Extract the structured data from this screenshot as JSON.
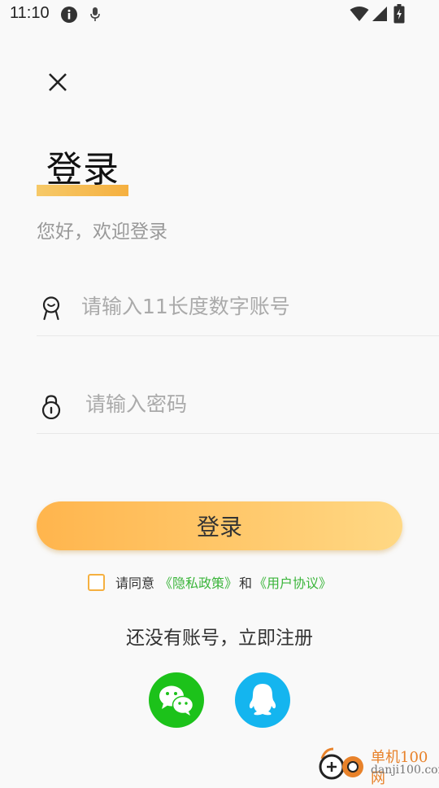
{
  "status_bar": {
    "time": "11:10",
    "icons": [
      "info-icon",
      "mic-icon",
      "wifi-icon",
      "signal-icon",
      "battery-icon"
    ]
  },
  "header": {
    "close_icon": "close-icon",
    "title": "登录",
    "subtitle": "您好，欢迎登录"
  },
  "form": {
    "account": {
      "placeholder": "请输入11长度数字账号",
      "value": "",
      "icon": "user-icon"
    },
    "password": {
      "placeholder": "请输入密码",
      "value": "",
      "icon": "lock-icon"
    },
    "login_label": "登录"
  },
  "agreement": {
    "checked": false,
    "prefix": "请同意",
    "privacy_link": "《隐私政策》",
    "conjunction": "和",
    "terms_link": "《用户协议》"
  },
  "register": {
    "label": "还没有账号，立即注册"
  },
  "social_login": [
    {
      "name": "wechat",
      "icon": "wechat-icon",
      "color": "#1cc21a"
    },
    {
      "name": "qq",
      "icon": "qq-icon",
      "color": "#14b5ef"
    }
  ],
  "watermark": {
    "name": "单机100网",
    "url": "danji100.com"
  },
  "colors": {
    "accent": "#f5b040",
    "link": "#3bb53b",
    "background": "#f9f9f9"
  }
}
